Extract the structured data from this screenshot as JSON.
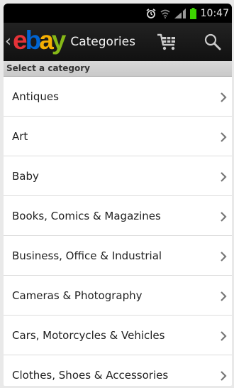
{
  "status_bar": {
    "time": "10:47",
    "icons": [
      "alarm-icon",
      "wifi-icon",
      "signal-icon",
      "battery-icon"
    ]
  },
  "action_bar": {
    "logo": {
      "letters": [
        "e",
        "b",
        "a",
        "y"
      ],
      "colors": [
        "#e53238",
        "#0064d2",
        "#f5af02",
        "#86b817"
      ]
    },
    "title": "Categories",
    "icons": [
      "back-chevron-icon",
      "cart-icon",
      "search-icon"
    ]
  },
  "section_header": "Select a category",
  "categories": [
    "Antiques",
    "Art",
    "Baby",
    "Books, Comics & Magazines",
    "Business, Office & Industrial",
    "Cameras & Photography",
    "Cars, Motorcycles & Vehicles",
    "Clothes, Shoes & Accessories"
  ],
  "colors": {
    "status_bg": "#000000",
    "actionbar_bg": "#1a1a1a",
    "header_bg": "#d3d3d3",
    "list_bg": "#ffffff",
    "battery": "#3dd400"
  }
}
